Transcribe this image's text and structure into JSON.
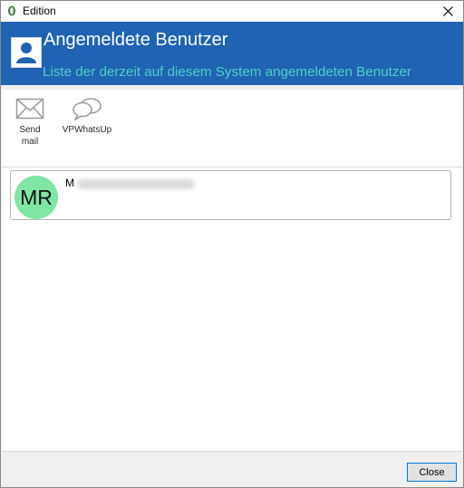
{
  "window": {
    "title": "Edition"
  },
  "header": {
    "title": "Angemeldete Benutzer",
    "subtitle": "Liste der derzeit auf diesem System angemeldeten Benutzer"
  },
  "toolbar": {
    "items": [
      {
        "label": "Send mail",
        "icon": "envelope-icon"
      },
      {
        "label": "VPWhatsUp",
        "icon": "chat-bubbles-icon"
      }
    ]
  },
  "users": [
    {
      "initials": "MR",
      "name": "M",
      "avatar_color": "#7fe6a5"
    }
  ],
  "footer": {
    "close_label": "Close"
  },
  "colors": {
    "header_bg": "#1f63b2",
    "subtitle": "#4fd0c8",
    "accent": "#0078d7"
  }
}
